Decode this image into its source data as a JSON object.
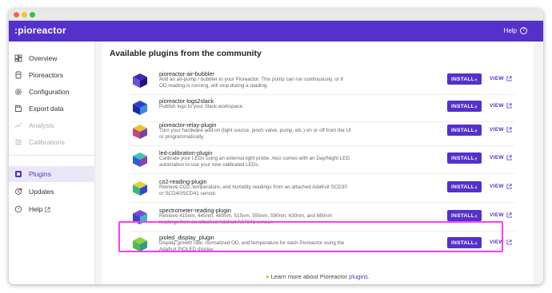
{
  "app": {
    "brand": ":pioreactor",
    "help_label": "Help"
  },
  "sidebar": {
    "items": [
      {
        "label": "Overview",
        "icon": "dashboard-icon",
        "state": "normal"
      },
      {
        "label": "Pioreactors",
        "icon": "pioreactor-icon",
        "state": "normal"
      },
      {
        "label": "Configuration",
        "icon": "gear-icon",
        "state": "normal"
      },
      {
        "label": "Export data",
        "icon": "save-icon",
        "state": "normal"
      },
      {
        "label": "Analysis",
        "icon": "insights-icon",
        "state": "disabled"
      },
      {
        "label": "Calibrations",
        "icon": "tune-icon",
        "state": "disabled"
      },
      {
        "label": "Plugins",
        "icon": "plugin-icon",
        "state": "active"
      },
      {
        "label": "Updates",
        "icon": "update-icon",
        "state": "normal"
      },
      {
        "label": "Help",
        "icon": "help-icon",
        "state": "normal"
      }
    ]
  },
  "main": {
    "section_title": "Available plugins from the community",
    "install_label": "INSTALL",
    "view_label": "VIEW",
    "plugins": [
      {
        "name": "pioreactor-air-bubbler",
        "description": "Add an air-pump / bubbler to your Pioreactor. This pump can run continuously, or if OD reading is running, will stop during a reading.",
        "colors": [
          "#3a2bbf",
          "#6b4fd9",
          "#1c1580"
        ]
      },
      {
        "name": "pioreactor-logs2slack",
        "description": "Publish logs to your Slack workspace.",
        "colors": [
          "#2c3fd0",
          "#1d2a9c",
          "#3b8be0"
        ]
      },
      {
        "name": "pioreactor-relay-plugin",
        "description": "Turn your hardware add-on (light source, pinch valve, pump, etc.) on or off from the UI or programmatically.",
        "colors": [
          "#e6c430",
          "#c9447b",
          "#7a3fa8"
        ]
      },
      {
        "name": "led-calibration-plugin",
        "description": "Calibrate your LEDs using an external light probe. Also comes with an Day/Night LED automation to use your new calibrated LEDs.",
        "colors": [
          "#3fc4b5",
          "#2f5fcf",
          "#8b3fb8"
        ]
      },
      {
        "name": "co2-reading-plugin",
        "description": "Retrieve CO2, temperature, and humidity readings from an attached Adafruit SCD30 or SCD40/SCD41 sensor.",
        "colors": [
          "#e3d23a",
          "#38b87a",
          "#2c4bd0"
        ]
      },
      {
        "name": "spectrometer-reading-plugin",
        "description": "Retrieve 415nm, 445nm, 480nm, 515nm, 555nm, 590nm, 630nm, and 680nm readings from an attached Adafruit AS7341 sensor.",
        "colors": [
          "#7b48d8",
          "#3a43c9",
          "#3db6c4"
        ]
      },
      {
        "name": "pioled_display_plugin",
        "description": "Display growth rate, normalized OD, and temperature for each Pioreactor using the Adafruit PiOLED display.",
        "colors": [
          "#8fd13f",
          "#4cbc53",
          "#2f9b8a"
        ]
      }
    ],
    "footer_prefix": "Learn more about Pioreactor",
    "footer_link": "plugins",
    "footer_suffix": "."
  },
  "colors": {
    "brand": "#5331ca",
    "highlight": "#ff3bf5"
  }
}
